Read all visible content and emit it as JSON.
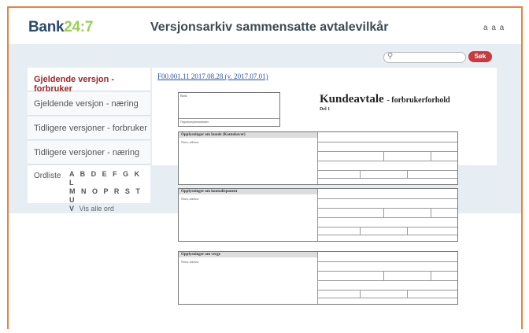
{
  "header": {
    "logo_main": "Bank",
    "logo_accent": "24:7",
    "title": "Versjonsarkiv sammensatte avtalevilkår",
    "font_size_control": "a a a"
  },
  "search": {
    "placeholder": "",
    "button_label": "Søk"
  },
  "sidebar": {
    "items": [
      {
        "label": "Gjeldende versjon - forbruker"
      },
      {
        "label": "Gjeldende versjon - næring"
      },
      {
        "label": "Tidligere versjoner - forbruker"
      },
      {
        "label": "Tidligere versjoner - næring"
      }
    ],
    "dictionary": {
      "label": "Ordliste",
      "letters_row1": "A B D E F G K L",
      "letters_row2": "M N O P R S T U",
      "letters_row3": "V",
      "show_all": "Vis alle ord"
    }
  },
  "content": {
    "version_link": "F00.001.11 2017.08.28 (v. 2017.07.01)"
  },
  "document": {
    "title": "Kundeavtale",
    "title_suffix": "- forbrukerforhold",
    "part": "Del 1",
    "bank_label": "Bank",
    "org_label": "Organisasjonsnummer",
    "section1": "Opplysninger om kunde (Kontohaver)",
    "section2": "Opplysninger om kontodisponent",
    "section3": "Opplysninger om verge",
    "field_name": "Navn, adresse"
  },
  "colors": {
    "frame_orange": "#e8833a",
    "logo_blue": "#2a4a6b",
    "logo_green": "#9ccf55",
    "active_red": "#a0262b",
    "search_button_red": "#c9393e",
    "band_blue": "#e6eef4"
  }
}
